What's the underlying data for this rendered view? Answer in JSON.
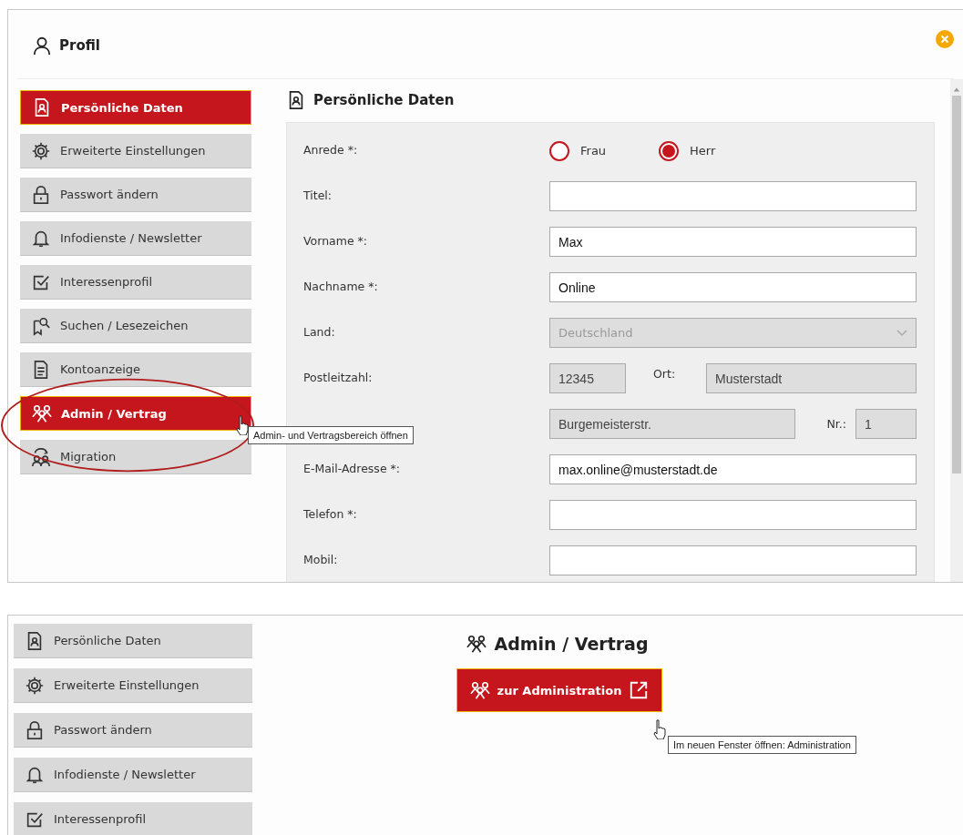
{
  "profile_window": {
    "title": "Profil",
    "sidebar": {
      "items": [
        {
          "label": "Persönliche Daten",
          "selected": true
        },
        {
          "label": "Erweiterte Einstellungen",
          "selected": false
        },
        {
          "label": "Passwort ändern",
          "selected": false
        },
        {
          "label": "Infodienste / Newsletter",
          "selected": false
        },
        {
          "label": "Interessenprofil",
          "selected": false
        },
        {
          "label": "Suchen / Lesezeichen",
          "selected": false
        },
        {
          "label": "Kontoanzeige",
          "selected": false
        },
        {
          "label": "Admin / Vertrag",
          "selected": true
        },
        {
          "label": "Migration",
          "selected": false
        }
      ]
    },
    "tooltip": "Admin- und Vertragsbereich öffnen",
    "section_title": "Persönliche Daten",
    "form": [
      {
        "kind": "radio",
        "label": "Anrede *:",
        "options": [
          {
            "label": "Frau",
            "selected": false
          },
          {
            "label": "Herr",
            "selected": true
          }
        ]
      },
      {
        "kind": "text",
        "label": "Titel:",
        "disabled": false
      },
      {
        "kind": "text",
        "label": "Vorname *:",
        "value": "Max",
        "disabled": false
      },
      {
        "kind": "text",
        "label": "Nachname *:",
        "value": "Online",
        "disabled": false
      },
      {
        "kind": "select",
        "label": "Land:",
        "value": "Deutschland",
        "disabled": true
      },
      {
        "kind": "zip",
        "label": "Postleitzahl:",
        "value": "12345",
        "second_label": "Ort:",
        "second_value": "Musterstadt",
        "disabled": true
      },
      {
        "kind": "street",
        "value": "Burgemeisterstr.",
        "second_label": "Nr.:",
        "second_value": "1",
        "disabled": true
      },
      {
        "kind": "text",
        "label": "E-Mail-Adresse *:",
        "value": "max.online@musterstadt.de",
        "disabled": false
      },
      {
        "kind": "text",
        "label": "Telefon *:",
        "disabled": false
      },
      {
        "kind": "text",
        "label": "Mobil:",
        "disabled": false
      }
    ]
  },
  "admin_window": {
    "sidebar": {
      "items": [
        {
          "label": "Persönliche Daten",
          "selected": false
        },
        {
          "label": "Erweiterte Einstellungen",
          "selected": false
        },
        {
          "label": "Passwort ändern",
          "selected": false
        },
        {
          "label": "Infodienste / Newsletter",
          "selected": false
        },
        {
          "label": "Interessenprofil",
          "selected": false
        }
      ]
    },
    "section_title": "Admin / Vertrag",
    "button": "zur Administration",
    "tooltip": "Im neuen Fenster öffnen: Administration"
  }
}
